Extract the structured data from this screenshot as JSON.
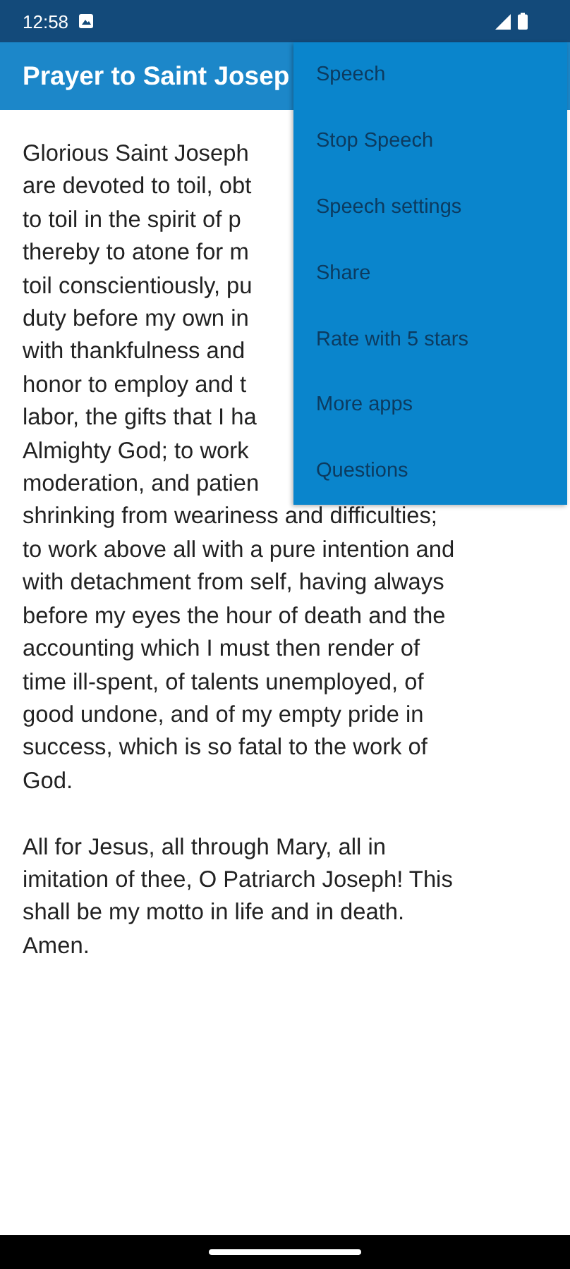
{
  "status_bar": {
    "time": "12:58"
  },
  "app_bar": {
    "title": "Prayer to Saint Josep"
  },
  "prayer": {
    "paragraphs": [
      {
        "lines": [
          "Glorious Saint Joseph",
          "are devoted to toil, obt",
          "to toil in the spirit of p",
          "thereby to atone for m",
          "toil conscientiously, pu",
          "duty before my own in",
          "with thankfulness and",
          "honor to employ and t",
          "labor, the gifts that I ha",
          "Almighty God; to work",
          "moderation, and patien",
          "shrinking from weariness and difficulties;",
          "to work above all with a pure intention and",
          "with detachment from self, having always",
          "before my eyes the hour of death and the",
          "accounting which I must then render of",
          "time ill-spent, of talents unemployed, of",
          "good undone, and of my empty pride in",
          "success, which is so fatal to the work of",
          "God."
        ]
      },
      {
        "lines": [
          "All for Jesus, all through Mary, all in",
          "imitation of thee, O Patriarch Joseph! This",
          "shall be my motto in life and in death.",
          "Amen."
        ]
      }
    ]
  },
  "menu": {
    "items": [
      "Speech",
      "Stop Speech",
      "Speech settings",
      "Share",
      "Rate with 5 stars",
      "More apps",
      "Questions"
    ]
  }
}
